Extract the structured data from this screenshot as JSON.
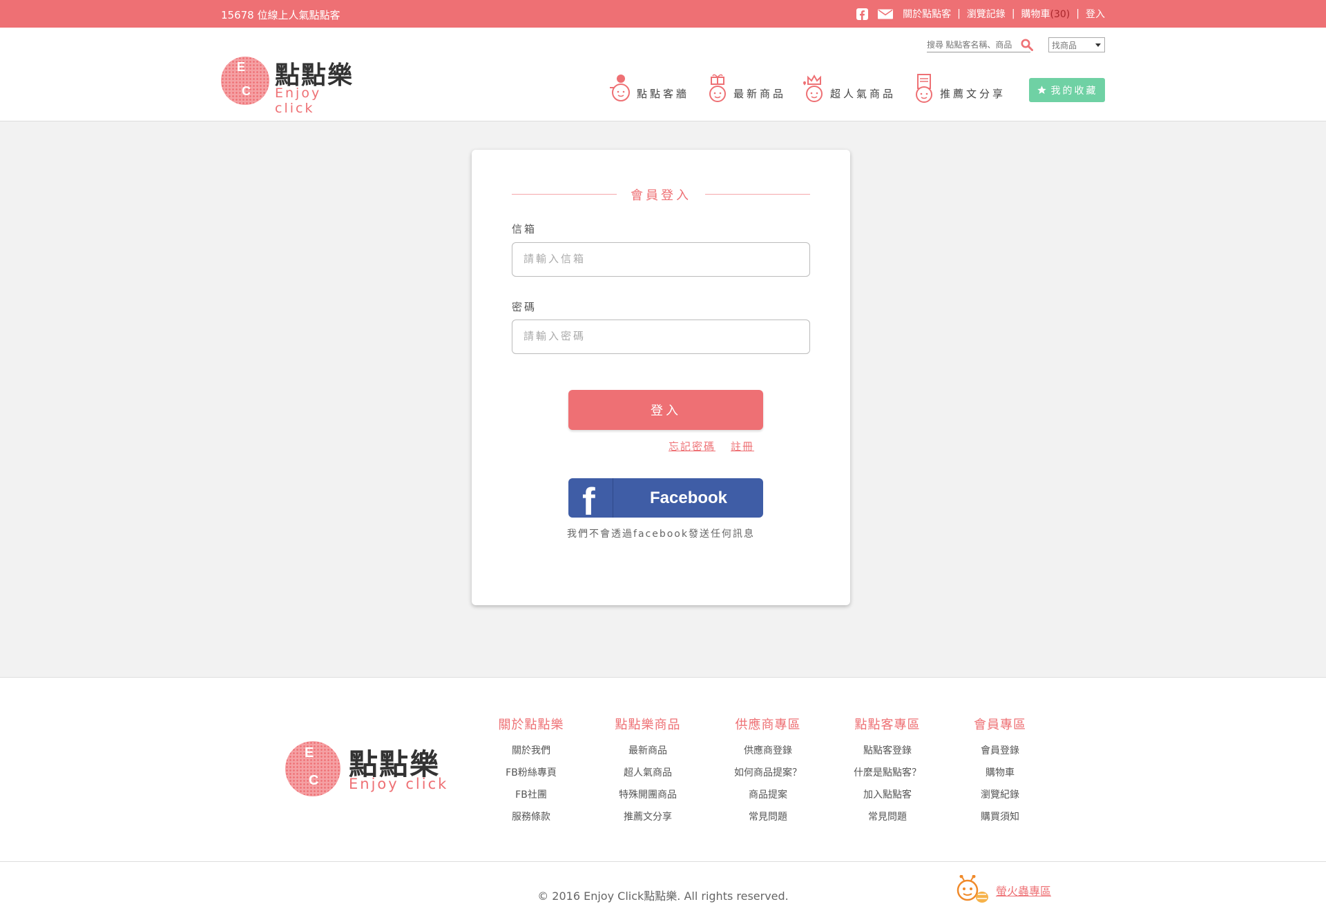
{
  "topbar": {
    "online_text": "15678 位線上人氣點點客",
    "links": {
      "about": "關於點點客",
      "history": "瀏覽記錄",
      "cart": "購物車",
      "cart_count": "(30)",
      "login": "登入"
    },
    "separator": "|"
  },
  "header": {
    "logo": {
      "word": "點點樂",
      "en": "Enjoy click",
      "letter_e": "E",
      "letter_c": "C"
    },
    "search": {
      "placeholder": "搜尋 點點客名稱、商品",
      "select_value": "找商品"
    },
    "nav": [
      {
        "label": "點點客牆",
        "icon": "avatar-face-icon"
      },
      {
        "label": "最新商品",
        "icon": "gift-face-icon"
      },
      {
        "label": "超人氣商品",
        "icon": "crown-face-icon"
      },
      {
        "label": "推薦文分享",
        "icon": "document-face-icon"
      }
    ],
    "favorites_label": "我的收藏"
  },
  "login": {
    "title": "會員登入",
    "email_label": "信箱",
    "email_placeholder": "請輸入信箱",
    "password_label": "密碼",
    "password_placeholder": "請輸入密碼",
    "submit_label": "登入",
    "forgot_label": "忘記密碼",
    "register_label": "註冊",
    "facebook_label": "Facebook",
    "facebook_note": "我們不會透過facebook發送任何訊息"
  },
  "footer": {
    "columns": [
      {
        "heading": "關於點點樂",
        "items": [
          "關於我們",
          "FB粉絲專頁",
          "FB社團",
          "服務條款"
        ]
      },
      {
        "heading": "點點樂商品",
        "items": [
          "最新商品",
          "超人氣商品",
          "特殊開團商品",
          "推薦文分享"
        ]
      },
      {
        "heading": "供應商專區",
        "items": [
          "供應商登錄",
          "如何商品提案？",
          "商品提案",
          "常見問題"
        ]
      },
      {
        "heading": "點點客專區",
        "items": [
          "點點客登錄",
          "什麼是點點客？",
          "加入點點客",
          "常見問題"
        ]
      },
      {
        "heading": "會員專區",
        "items": [
          "會員登錄",
          "購物車",
          "瀏覽紀錄",
          "購買須知"
        ]
      }
    ],
    "copyright": "© 2016 Enjoy Click點點樂. All rights reserved.",
    "firefly_label": "螢火蟲專區"
  },
  "colors": {
    "brand": "#ee7074",
    "accent_green": "#6fd1a4",
    "facebook": "#3f5da6"
  }
}
